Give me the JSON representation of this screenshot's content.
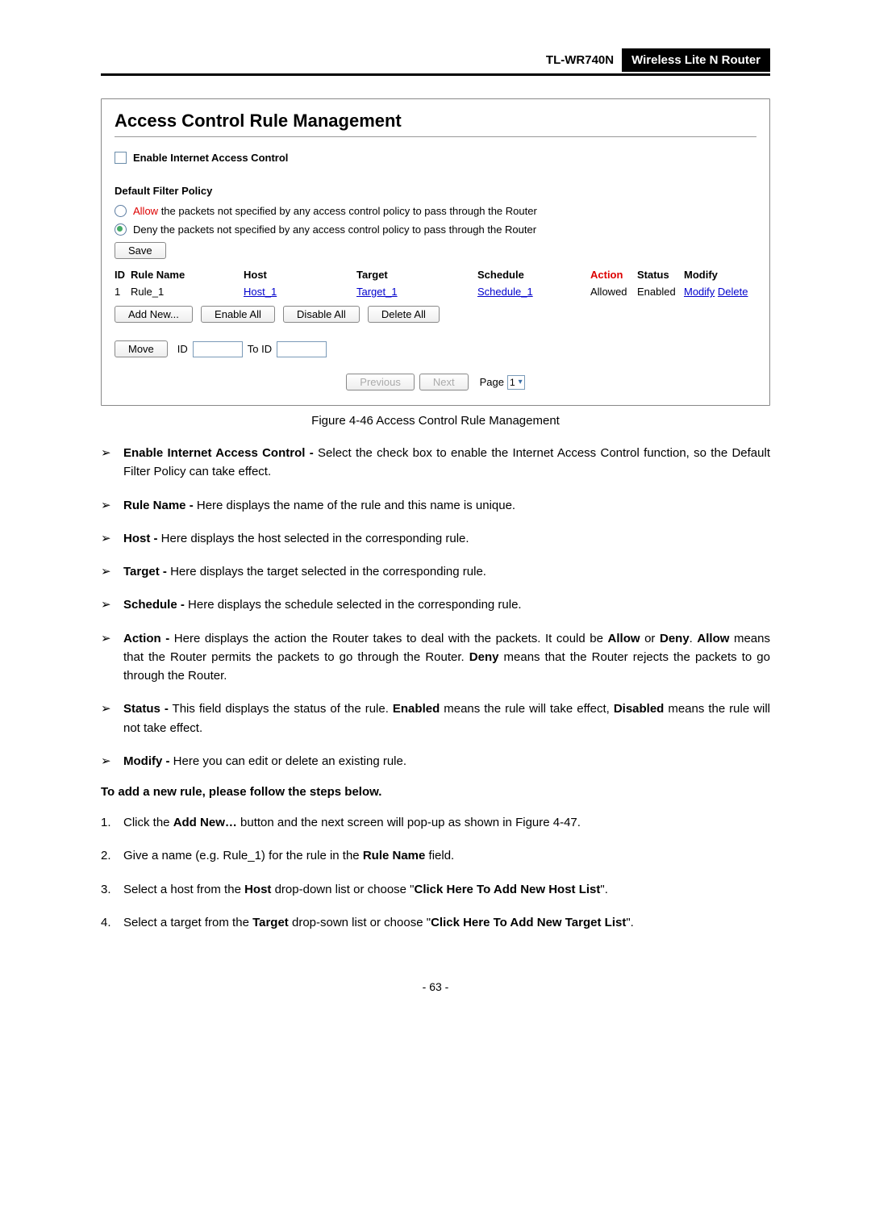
{
  "header": {
    "model": "TL-WR740N",
    "desc": "Wireless Lite N Router"
  },
  "panel": {
    "title": "Access Control Rule Management",
    "enable_label": "Enable Internet Access Control",
    "policy_heading": "Default Filter Policy",
    "allow_word": "Allow",
    "allow_rest": " the packets not specified by any access control policy to pass through the Router",
    "deny_text": "Deny the packets not specified by any access control policy to pass through the Router",
    "save": "Save",
    "head": {
      "id": "ID",
      "name": "Rule Name",
      "host": "Host",
      "target": "Target",
      "schedule": "Schedule",
      "action": "Action",
      "status": "Status",
      "modify": "Modify"
    },
    "rows": [
      {
        "id": "1",
        "name": "Rule_1",
        "host": "Host_1",
        "target": "Target_1",
        "schedule": "Schedule_1",
        "action": "Allowed",
        "status": "Enabled",
        "modify": "Modify",
        "delete": "Delete"
      }
    ],
    "buttons": {
      "addnew": "Add New...",
      "enableall": "Enable All",
      "disableall": "Disable All",
      "deleteall": "Delete All",
      "move": "Move",
      "id_lbl": "ID",
      "toid": "To ID",
      "prev": "Previous",
      "next": "Next",
      "page": "Page",
      "page_val": "1"
    }
  },
  "figcap": "Figure 4-46    Access Control Rule Management",
  "body": {
    "p1a": "Enable Internet Access Control -",
    "p1b": " Select the check box to enable the Internet Access Control function, so the Default Filter Policy can take effect.",
    "p2a": "Rule Name -",
    "p2b": " Here displays the name of the rule and this name is unique.",
    "p3a": "Host -",
    "p3b": " Here displays the host selected in the corresponding rule.",
    "p4a": "Target -",
    "p4b": " Here displays the target selected in the corresponding rule.",
    "p5a": "Schedule -",
    "p5b": " Here displays the schedule selected in the corresponding rule.",
    "p6a": "Action -",
    "p6b": " Here displays the action the Router takes to deal with the packets. It could be ",
    "p6c": "Allow",
    "p6d": " or ",
    "p6e": "Deny",
    "p6f": ". ",
    "p6g": "Allow",
    "p6h": " means that the Router permits the packets to go through the Router. ",
    "p6i": "Deny",
    "p6j": " means that the Router rejects the packets to go through the Router.",
    "p7a": "Status -",
    "p7b": " This field displays the status of the rule. ",
    "p7c": "Enabled",
    "p7d": " means the rule will take effect, ",
    "p7e": "Disabled",
    "p7f": " means the rule will not take effect.",
    "p8a": "Modify -",
    "p8b": " Here you can edit or delete an existing rule.",
    "sub": "To add a new rule, please follow the steps below.",
    "s1a": "Click the ",
    "s1b": "Add New…",
    "s1c": " button and the next screen will pop-up as shown in Figure 4-47.",
    "s2a": "Give a name (e.g. Rule_1) for the rule in the ",
    "s2b": "Rule Name",
    "s2c": " field.",
    "s3a": "Select a host from the ",
    "s3b": "Host",
    "s3c": " drop-down list or choose \"",
    "s3d": "Click Here To Add New Host List",
    "s3e": "\".",
    "s4a": "Select a target from the ",
    "s4b": "Target",
    "s4c": " drop-sown list or choose \"",
    "s4d": "Click Here To Add New Target List",
    "s4e": "\"."
  },
  "footer": "- 63 -"
}
